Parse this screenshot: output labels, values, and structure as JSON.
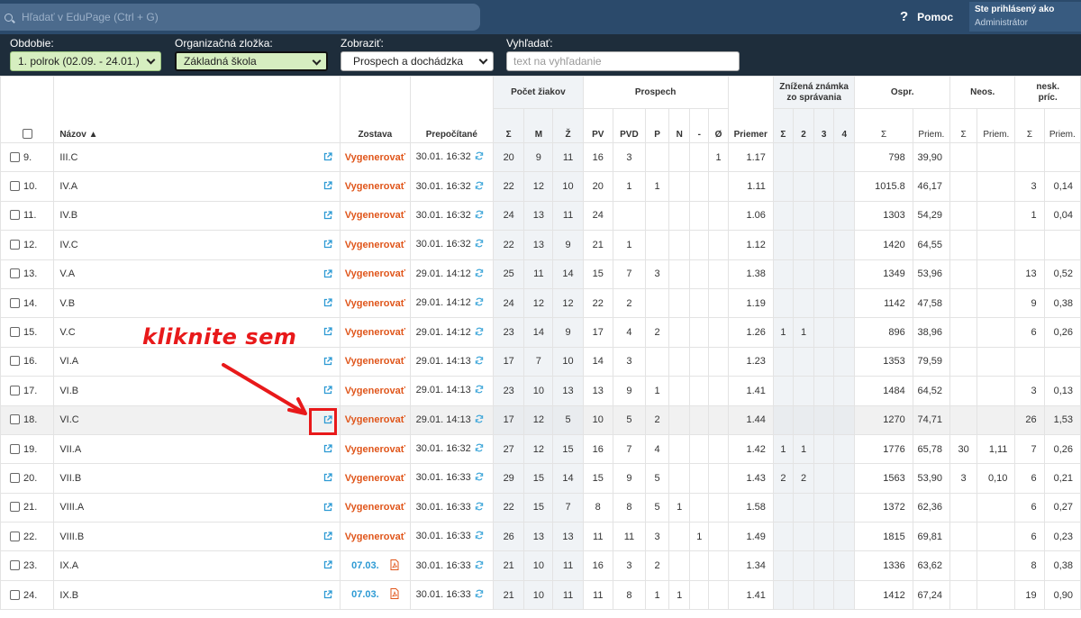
{
  "topbar": {
    "search_placeholder": "Hľadať v EduPage (Ctrl + G)",
    "help_label": "Pomoc",
    "user_line1": "Ste prihlásený ako",
    "user_line2": "Administrátor"
  },
  "filters": {
    "period_label": "Obdobie:",
    "period_value": "1. polrok (02.09. - 24.01.)",
    "org_label": "Organizačná zložka:",
    "org_value": "Základná škola",
    "show_label": "Zobraziť:",
    "show_value": "Prospech a dochádzka",
    "search_label": "Vyhľadať:",
    "search_placeholder": "text na vyhľadanie"
  },
  "header": {
    "name": "Názov",
    "report": "Zostava",
    "recalc": "Prepočítané",
    "students_group": "Počet žiakov",
    "grades_group": "Prospech",
    "behavior_group_l1": "Znížená známka",
    "behavior_group_l2": "zo správania",
    "excused_group": "Ospr.",
    "unexcused_group": "Neos.",
    "unexc_count_l1": "nesk.",
    "unexc_count_l2": "príc.",
    "sub_students": [
      "Σ",
      "M",
      "Ž"
    ],
    "sub_grades": [
      "PV",
      "PVD",
      "P",
      "N",
      "-",
      "Ø"
    ],
    "average": "Priemer",
    "sub_behavior": [
      "Σ",
      "2",
      "3",
      "4"
    ],
    "sub_excused": [
      "Σ",
      "Priem."
    ],
    "sub_unexcused": [
      "Σ",
      "Priem."
    ],
    "sub_late": [
      "Σ",
      "Priem."
    ]
  },
  "annotation": "kliknite sem",
  "rows": [
    {
      "idx": "9.",
      "name": "III.C",
      "report": "Vygenerovať",
      "date": "30.01. 16:32",
      "s": "20",
      "m": "9",
      "z": "11",
      "pv": "16",
      "pvd": "3",
      "p": "",
      "n": "",
      "dash": "",
      "o": "1",
      "avg": "1.17",
      "b1": "",
      "b2": "",
      "b3": "",
      "b4": "",
      "osum": "798",
      "oavg": "39,90",
      "nsum": "",
      "navg": "",
      "lsum": "",
      "lavg": ""
    },
    {
      "idx": "10.",
      "name": "IV.A",
      "report": "Vygenerovať",
      "date": "30.01. 16:32",
      "s": "22",
      "m": "12",
      "z": "10",
      "pv": "20",
      "pvd": "1",
      "p": "1",
      "n": "",
      "dash": "",
      "o": "",
      "avg": "1.11",
      "b1": "",
      "b2": "",
      "b3": "",
      "b4": "",
      "osum": "1015.8",
      "oavg": "46,17",
      "nsum": "",
      "navg": "",
      "lsum": "3",
      "lavg": "0,14"
    },
    {
      "idx": "11.",
      "name": "IV.B",
      "report": "Vygenerovať",
      "date": "30.01. 16:32",
      "s": "24",
      "m": "13",
      "z": "11",
      "pv": "24",
      "pvd": "",
      "p": "",
      "n": "",
      "dash": "",
      "o": "",
      "avg": "1.06",
      "b1": "",
      "b2": "",
      "b3": "",
      "b4": "",
      "osum": "1303",
      "oavg": "54,29",
      "nsum": "",
      "navg": "",
      "lsum": "1",
      "lavg": "0,04"
    },
    {
      "idx": "12.",
      "name": "IV.C",
      "report": "Vygenerovať",
      "date": "30.01. 16:32",
      "s": "22",
      "m": "13",
      "z": "9",
      "pv": "21",
      "pvd": "1",
      "p": "",
      "n": "",
      "dash": "",
      "o": "",
      "avg": "1.12",
      "b1": "",
      "b2": "",
      "b3": "",
      "b4": "",
      "osum": "1420",
      "oavg": "64,55",
      "nsum": "",
      "navg": "",
      "lsum": "",
      "lavg": ""
    },
    {
      "idx": "13.",
      "name": "V.A",
      "report": "Vygenerovať",
      "date": "29.01. 14:12",
      "s": "25",
      "m": "11",
      "z": "14",
      "pv": "15",
      "pvd": "7",
      "p": "3",
      "n": "",
      "dash": "",
      "o": "",
      "avg": "1.38",
      "b1": "",
      "b2": "",
      "b3": "",
      "b4": "",
      "osum": "1349",
      "oavg": "53,96",
      "nsum": "",
      "navg": "",
      "lsum": "13",
      "lavg": "0,52"
    },
    {
      "idx": "14.",
      "name": "V.B",
      "report": "Vygenerovať",
      "date": "29.01. 14:12",
      "s": "24",
      "m": "12",
      "z": "12",
      "pv": "22",
      "pvd": "2",
      "p": "",
      "n": "",
      "dash": "",
      "o": "",
      "avg": "1.19",
      "b1": "",
      "b2": "",
      "b3": "",
      "b4": "",
      "osum": "1142",
      "oavg": "47,58",
      "nsum": "",
      "navg": "",
      "lsum": "9",
      "lavg": "0,38"
    },
    {
      "idx": "15.",
      "name": "V.C",
      "report": "Vygenerovať",
      "date": "29.01. 14:12",
      "s": "23",
      "m": "14",
      "z": "9",
      "pv": "17",
      "pvd": "4",
      "p": "2",
      "n": "",
      "dash": "",
      "o": "",
      "avg": "1.26",
      "b1": "1",
      "b2": "1",
      "b3": "",
      "b4": "",
      "osum": "896",
      "oavg": "38,96",
      "nsum": "",
      "navg": "",
      "lsum": "6",
      "lavg": "0,26"
    },
    {
      "idx": "16.",
      "name": "VI.A",
      "report": "Vygenerovať",
      "date": "29.01. 14:13",
      "s": "17",
      "m": "7",
      "z": "10",
      "pv": "14",
      "pvd": "3",
      "p": "",
      "n": "",
      "dash": "",
      "o": "",
      "avg": "1.23",
      "b1": "",
      "b2": "",
      "b3": "",
      "b4": "",
      "osum": "1353",
      "oavg": "79,59",
      "nsum": "",
      "navg": "",
      "lsum": "",
      "lavg": ""
    },
    {
      "idx": "17.",
      "name": "VI.B",
      "report": "Vygenerovať",
      "date": "29.01. 14:13",
      "s": "23",
      "m": "10",
      "z": "13",
      "pv": "13",
      "pvd": "9",
      "p": "1",
      "n": "",
      "dash": "",
      "o": "",
      "avg": "1.41",
      "b1": "",
      "b2": "",
      "b3": "",
      "b4": "",
      "osum": "1484",
      "oavg": "64,52",
      "nsum": "",
      "navg": "",
      "lsum": "3",
      "lavg": "0,13"
    },
    {
      "idx": "18.",
      "name": "VI.C",
      "report": "Vygenerovať",
      "date": "29.01. 14:13",
      "s": "17",
      "m": "12",
      "z": "5",
      "pv": "10",
      "pvd": "5",
      "p": "2",
      "n": "",
      "dash": "",
      "o": "",
      "avg": "1.44",
      "b1": "",
      "b2": "",
      "b3": "",
      "b4": "",
      "osum": "1270",
      "oavg": "74,71",
      "nsum": "",
      "navg": "",
      "lsum": "26",
      "lavg": "1,53",
      "highlight": true
    },
    {
      "idx": "19.",
      "name": "VII.A",
      "report": "Vygenerovať",
      "date": "30.01. 16:32",
      "s": "27",
      "m": "12",
      "z": "15",
      "pv": "16",
      "pvd": "7",
      "p": "4",
      "n": "",
      "dash": "",
      "o": "",
      "avg": "1.42",
      "b1": "1",
      "b2": "1",
      "b3": "",
      "b4": "",
      "osum": "1776",
      "oavg": "65,78",
      "nsum": "30",
      "navg": "1,11",
      "lsum": "7",
      "lavg": "0,26"
    },
    {
      "idx": "20.",
      "name": "VII.B",
      "report": "Vygenerovať",
      "date": "30.01. 16:33",
      "s": "29",
      "m": "15",
      "z": "14",
      "pv": "15",
      "pvd": "9",
      "p": "5",
      "n": "",
      "dash": "",
      "o": "",
      "avg": "1.43",
      "b1": "2",
      "b2": "2",
      "b3": "",
      "b4": "",
      "osum": "1563",
      "oavg": "53,90",
      "nsum": "3",
      "navg": "0,10",
      "lsum": "6",
      "lavg": "0,21"
    },
    {
      "idx": "21.",
      "name": "VIII.A",
      "report": "Vygenerovať",
      "date": "30.01. 16:33",
      "s": "22",
      "m": "15",
      "z": "7",
      "pv": "8",
      "pvd": "8",
      "p": "5",
      "n": "1",
      "dash": "",
      "o": "",
      "avg": "1.58",
      "b1": "",
      "b2": "",
      "b3": "",
      "b4": "",
      "osum": "1372",
      "oavg": "62,36",
      "nsum": "",
      "navg": "",
      "lsum": "6",
      "lavg": "0,27"
    },
    {
      "idx": "22.",
      "name": "VIII.B",
      "report": "Vygenerovať",
      "date": "30.01. 16:33",
      "s": "26",
      "m": "13",
      "z": "13",
      "pv": "11",
      "pvd": "11",
      "p": "3",
      "n": "",
      "dash": "1",
      "o": "",
      "avg": "1.49",
      "b1": "",
      "b2": "",
      "b3": "",
      "b4": "",
      "osum": "1815",
      "oavg": "69,81",
      "nsum": "",
      "navg": "",
      "lsum": "6",
      "lavg": "0,23"
    },
    {
      "idx": "23.",
      "name": "IX.A",
      "report": "07.03.",
      "reportType": "link",
      "date": "30.01. 16:33",
      "s": "21",
      "m": "10",
      "z": "11",
      "pv": "16",
      "pvd": "3",
      "p": "2",
      "n": "",
      "dash": "",
      "o": "",
      "avg": "1.34",
      "b1": "",
      "b2": "",
      "b3": "",
      "b4": "",
      "osum": "1336",
      "oavg": "63,62",
      "nsum": "",
      "navg": "",
      "lsum": "8",
      "lavg": "0,38"
    },
    {
      "idx": "24.",
      "name": "IX.B",
      "report": "07.03.",
      "reportType": "link",
      "date": "30.01. 16:33",
      "s": "21",
      "m": "10",
      "z": "11",
      "pv": "11",
      "pvd": "8",
      "p": "1",
      "n": "1",
      "dash": "",
      "o": "",
      "avg": "1.41",
      "b1": "",
      "b2": "",
      "b3": "",
      "b4": "",
      "osum": "1412",
      "oavg": "67,24",
      "nsum": "",
      "navg": "",
      "lsum": "19",
      "lavg": "0,90"
    }
  ]
}
